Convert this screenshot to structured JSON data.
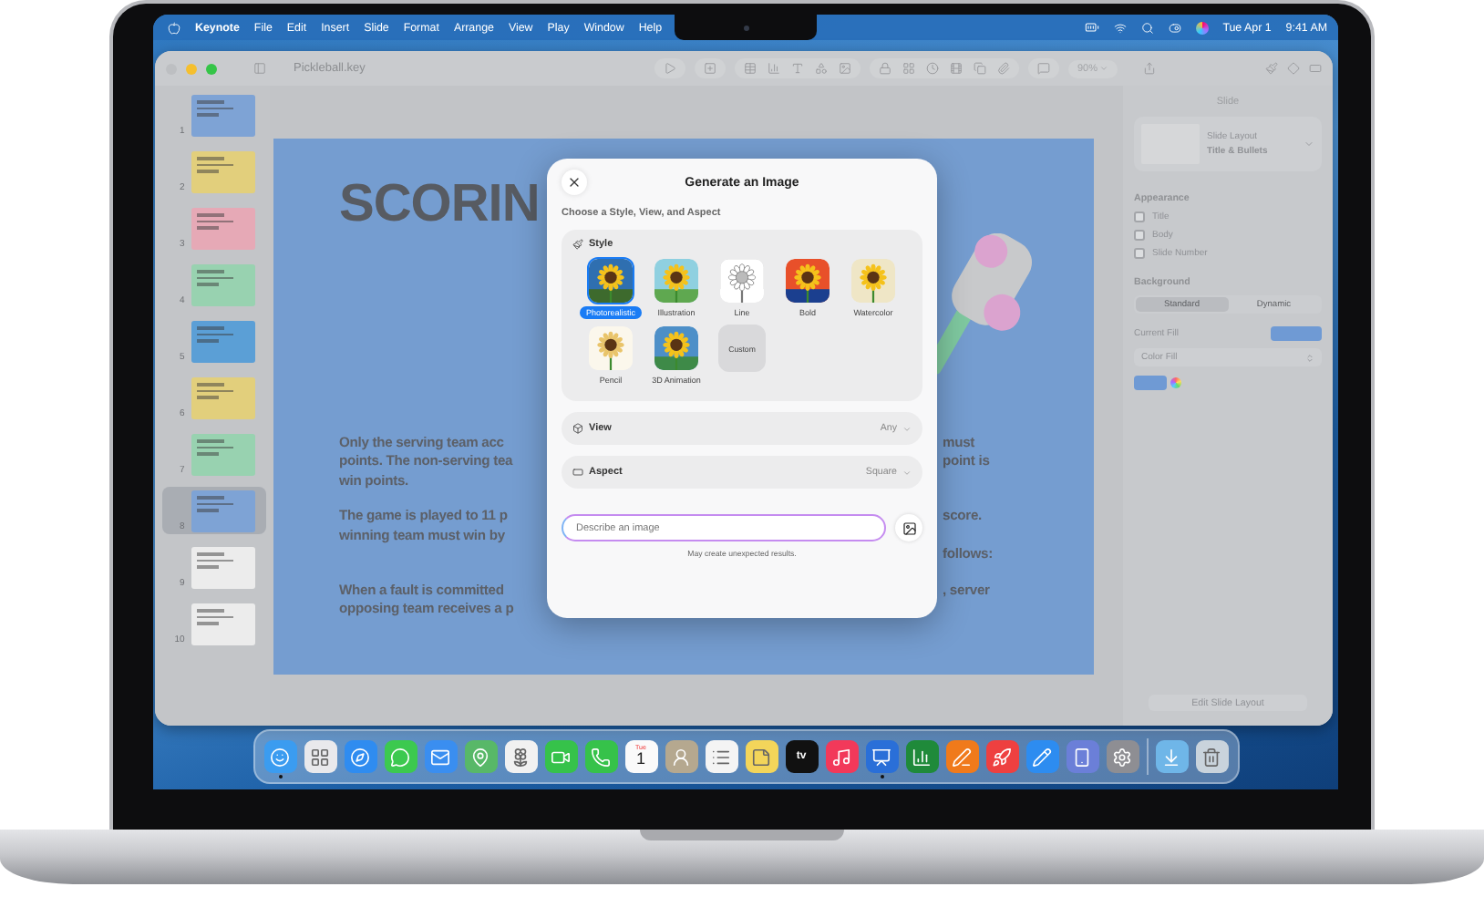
{
  "menubar": {
    "app": "Keynote",
    "menus": [
      "File",
      "Edit",
      "Insert",
      "Slide",
      "Format",
      "Arrange",
      "View",
      "Play",
      "Window",
      "Help"
    ],
    "date": "Tue Apr 1",
    "time": "9:41 AM"
  },
  "toolbar": {
    "document_title": "Pickleball.key",
    "zoom": "90%"
  },
  "slides": [
    {
      "number": "1",
      "color": "#7ea3d5",
      "selected": false
    },
    {
      "number": "2",
      "color": "#e2cf7c",
      "selected": false
    },
    {
      "number": "3",
      "color": "#e6a9b6",
      "selected": false
    },
    {
      "number": "4",
      "color": "#98d2b0",
      "selected": false
    },
    {
      "number": "5",
      "color": "#5b9fd6",
      "selected": false
    },
    {
      "number": "6",
      "color": "#e2cf7c",
      "selected": false
    },
    {
      "number": "7",
      "color": "#98d2b0",
      "selected": false
    },
    {
      "number": "8",
      "color": "#7ea3d5",
      "selected": true
    },
    {
      "number": "9",
      "color": "#ececec",
      "selected": false
    },
    {
      "number": "10",
      "color": "#ececec",
      "selected": false
    }
  ],
  "slide": {
    "title": "SCORIN",
    "paragraphs": [
      [
        {
          "left": "Only the serving team acc",
          "right": "must"
        },
        {
          "left": "points. The non-serving tea",
          "right": "point is"
        },
        {
          "left": "win points."
        }
      ],
      [
        {
          "left": "The game is played to 11 p",
          "right": "score."
        },
        {
          "left": "winning team must win by"
        },
        {
          "right": "follows:"
        }
      ],
      [
        {
          "left": "When a fault is committed",
          "right": ", server"
        },
        {
          "left": "opposing team receives a p"
        }
      ]
    ]
  },
  "dialog": {
    "title": "Generate an Image",
    "subtitle": "Choose a Style, View, and Aspect",
    "style_heading": "Style",
    "styles": [
      {
        "label": "Photorealistic",
        "kind": "photo",
        "selected": true
      },
      {
        "label": "Illustration",
        "kind": "illustration",
        "selected": false
      },
      {
        "label": "Line",
        "kind": "line",
        "selected": false
      },
      {
        "label": "Bold",
        "kind": "bold",
        "selected": false
      },
      {
        "label": "Watercolor",
        "kind": "watercolor",
        "selected": false
      },
      {
        "label": "Pencil",
        "kind": "pencil",
        "selected": false
      },
      {
        "label": "3D Animation",
        "kind": "animation",
        "selected": false
      },
      {
        "label": "Custom",
        "kind": "custom",
        "selected": false
      }
    ],
    "view": {
      "label": "View",
      "value": "Any"
    },
    "aspect": {
      "label": "Aspect",
      "value": "Square"
    },
    "prompt": {
      "placeholder": "Describe an image"
    },
    "note": "May create unexpected results."
  },
  "inspector": {
    "title": "Slide",
    "layout_label": "Slide Layout",
    "layout_value": "Title & Bullets",
    "appearance_heading": "Appearance",
    "appearance": [
      {
        "label": "Title",
        "checked": false
      },
      {
        "label": "Body",
        "checked": false
      },
      {
        "label": "Slide Number",
        "checked": false
      }
    ],
    "background_heading": "Background",
    "background_modes": [
      {
        "label": "Standard",
        "selected": true
      },
      {
        "label": "Dynamic",
        "selected": false
      }
    ],
    "current_fill_label": "Current Fill",
    "fill_type": "Color Fill",
    "edit_button": "Edit Slide Layout"
  },
  "dock": [
    {
      "kind": "finder",
      "running": true
    },
    {
      "kind": "launchpad",
      "running": false
    },
    {
      "kind": "safari",
      "running": false
    },
    {
      "kind": "messages",
      "running": false
    },
    {
      "kind": "mail",
      "running": false
    },
    {
      "kind": "maps",
      "running": false
    },
    {
      "kind": "photos",
      "running": false
    },
    {
      "kind": "facetime",
      "running": false
    },
    {
      "kind": "phone",
      "running": false
    },
    {
      "kind": "calendar",
      "month": "Tue",
      "day": "1",
      "running": false
    },
    {
      "kind": "contacts",
      "running": false
    },
    {
      "kind": "reminders",
      "running": false
    },
    {
      "kind": "notes",
      "running": false
    },
    {
      "kind": "tv",
      "label": "tv",
      "running": false
    },
    {
      "kind": "music",
      "running": false
    },
    {
      "kind": "keynote",
      "running": true
    },
    {
      "kind": "numbers",
      "running": false
    },
    {
      "kind": "pages",
      "running": false
    },
    {
      "kind": "rocket",
      "running": false
    },
    {
      "kind": "appstore",
      "running": false
    },
    {
      "kind": "mirroring",
      "running": false
    },
    {
      "kind": "settings",
      "running": false
    },
    {
      "kind": "separator"
    },
    {
      "kind": "downloads",
      "running": false
    },
    {
      "kind": "trash",
      "running": false
    }
  ]
}
